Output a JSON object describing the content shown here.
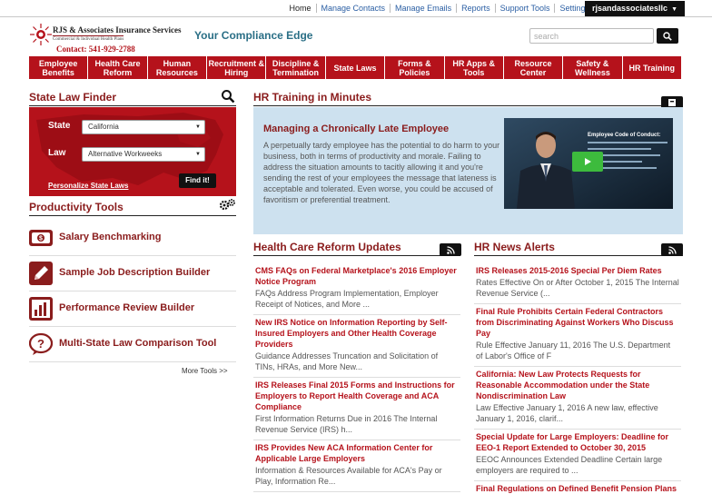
{
  "topbar": {
    "links": [
      "Home",
      "Manage Contacts",
      "Manage Emails",
      "Reports",
      "Support Tools",
      "Settings"
    ],
    "account": "rjsandassociatesllc"
  },
  "header": {
    "logo_name": "RJS & Associates Insurance Services",
    "logo_sub": "Commercial & Individual Health Plans",
    "logo_contact": "Contact: 541-929-2788",
    "tagline": "Your Compliance Edge",
    "search_placeholder": "search"
  },
  "nav": [
    "Employee Benefits",
    "Health Care Reform",
    "Human Resources",
    "Recruitment & Hiring",
    "Discipline & Termination",
    "State Laws",
    "Forms & Policies",
    "HR Apps & Tools",
    "Resource Center",
    "Safety & Wellness",
    "HR Training"
  ],
  "state_law_finder": {
    "title": "State Law Finder",
    "state_label": "State",
    "state_value": "California",
    "law_label": "Law",
    "law_value": "Alternative Workweeks",
    "personalize_link": "Personalize State Laws",
    "find_button": "Find it!"
  },
  "productivity": {
    "title": "Productivity Tools",
    "tools": [
      "Salary Benchmarking",
      "Sample Job Description Builder",
      "Performance Review Builder",
      "Multi-State Law Comparison Tool"
    ],
    "more": "More Tools >>"
  },
  "training": {
    "title": "HR Training in Minutes",
    "item_title": "Managing a Chronically Late Employee",
    "item_body": "A perpetually tardy employee has the potential to do harm to your business, both in terms of productivity and morale. Failing to address the situation amounts to tacitly allowing it and you're sending the rest of your employees the message that lateness is acceptable and tolerated. Even worse, you could be accused of favoritism or preferential treatment.",
    "video_caption": "Employee Code of Conduct:"
  },
  "hcr": {
    "title": "Health Care Reform Updates",
    "items": [
      {
        "title": "CMS FAQs on Federal Marketplace's 2016 Employer Notice Program",
        "desc": "FAQs Address Program Implementation, Employer Receipt of Notices, and More ..."
      },
      {
        "title": "New IRS Notice on Information Reporting by Self-Insured Employers and Other Health Coverage Providers",
        "desc": "Guidance Addresses Truncation and Solicitation of TINs, HRAs, and More New..."
      },
      {
        "title": "IRS Releases Final 2015 Forms and Instructions for Employers to Report Health Coverage and ACA Compliance",
        "desc": "First Information Returns Due in 2016 The Internal Revenue Service (IRS) h..."
      },
      {
        "title": "IRS Provides New ACA Information Center for Applicable Large Employers",
        "desc": "Information & Resources Available for ACA's Pay or Play, Information Re..."
      }
    ]
  },
  "hrnews": {
    "title": "HR News Alerts",
    "items": [
      {
        "title": "IRS Releases 2015-2016 Special Per Diem Rates",
        "desc": "Rates Effective On or After October 1, 2015 The Internal Revenue Service (..."
      },
      {
        "title": "Final Rule Prohibits Certain Federal Contractors from Discriminating Against Workers Who Discuss Pay",
        "desc": "Rule Effective January 11, 2016 The U.S. Department of Labor's Office of F"
      },
      {
        "title": "California: New Law Protects Requests for Reasonable Accommodation under the State Nondiscrimination Law",
        "desc": "Law Effective January 1, 2016 A new law, effective January 1, 2016, clarif..."
      },
      {
        "title": "Special Update for Large Employers: Deadline for EEO-1 Report Extended to October 30, 2015",
        "desc": "EEOC Announces Extended Deadline Certain large employers are required to ..."
      },
      {
        "title": "Final Regulations on Defined Benefit Pension Plans",
        "desc": ""
      }
    ]
  }
}
